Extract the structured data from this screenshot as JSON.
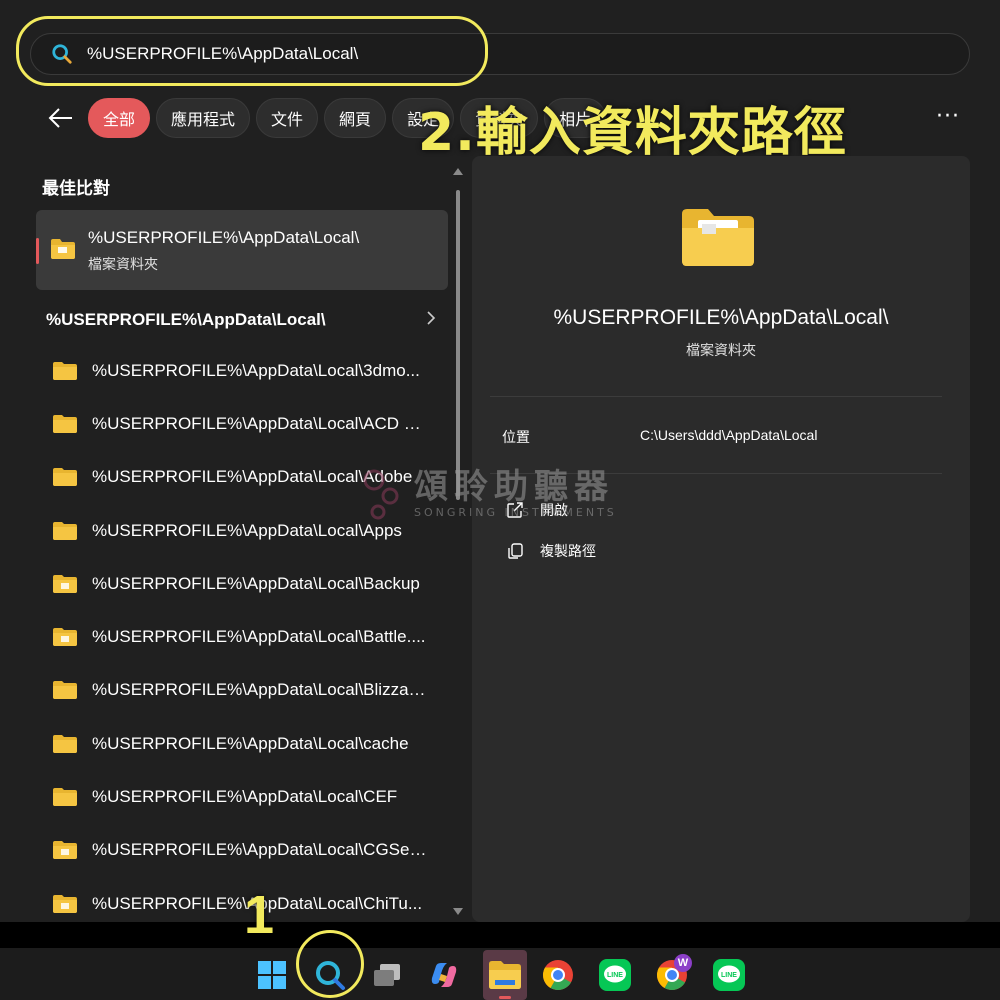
{
  "search": {
    "value": "%USERPROFILE%\\AppData\\Local\\",
    "placeholder": ""
  },
  "filters": {
    "chips": [
      {
        "label": "全部",
        "active": true
      },
      {
        "label": "應用程式",
        "active": false
      },
      {
        "label": "文件",
        "active": false
      },
      {
        "label": "網頁",
        "active": false
      },
      {
        "label": "設定",
        "active": false
      },
      {
        "label": "資料夾",
        "active": false
      },
      {
        "label": "相片",
        "active": false
      }
    ]
  },
  "annotations": {
    "step2": "2.輸入資料夾路徑",
    "step1": "1"
  },
  "results": {
    "best_match_title": "最佳比對",
    "best_match": {
      "name": "%USERPROFILE%\\AppData\\Local\\",
      "type": "檔案資料夾"
    },
    "group_header": "%USERPROFILE%\\AppData\\Local\\",
    "items": [
      "%USERPROFILE%\\AppData\\Local\\3dmo...",
      "%USERPROFILE%\\AppData\\Local\\ACD S...",
      "%USERPROFILE%\\AppData\\Local\\Adobe",
      "%USERPROFILE%\\AppData\\Local\\Apps",
      "%USERPROFILE%\\AppData\\Local\\Backup",
      "%USERPROFILE%\\AppData\\Local\\Battle....",
      "%USERPROFILE%\\AppData\\Local\\Blizzar...",
      "%USERPROFILE%\\AppData\\Local\\cache",
      "%USERPROFILE%\\AppData\\Local\\CEF",
      "%USERPROFILE%\\AppData\\Local\\CGSer...",
      "%USERPROFILE%\\AppData\\Local\\ChiTu..."
    ]
  },
  "details": {
    "title": "%USERPROFILE%\\AppData\\Local\\",
    "type": "檔案資料夾",
    "location_label": "位置",
    "location_value": "C:\\Users\\ddd\\AppData\\Local",
    "actions": [
      {
        "label": "開啟",
        "icon": "open-external-icon"
      },
      {
        "label": "複製路徑",
        "icon": "copy-icon"
      }
    ]
  },
  "watermark": {
    "title": "頌聆助聽器",
    "subtitle": "SONGRING INSTRUMENTS"
  },
  "taskbar": {
    "icons": [
      "windows-start-icon",
      "search-icon",
      "task-view-icon",
      "copilot-icon",
      "file-explorer-icon",
      "chrome-icon",
      "line-icon",
      "chrome-profile-icon",
      "line-icon"
    ],
    "badge": "W"
  },
  "colors": {
    "accent": "#e4595b",
    "annotation": "#f2ea5d",
    "folder": "#f5c542",
    "background": "#202020",
    "panel": "#2b2b2b"
  }
}
